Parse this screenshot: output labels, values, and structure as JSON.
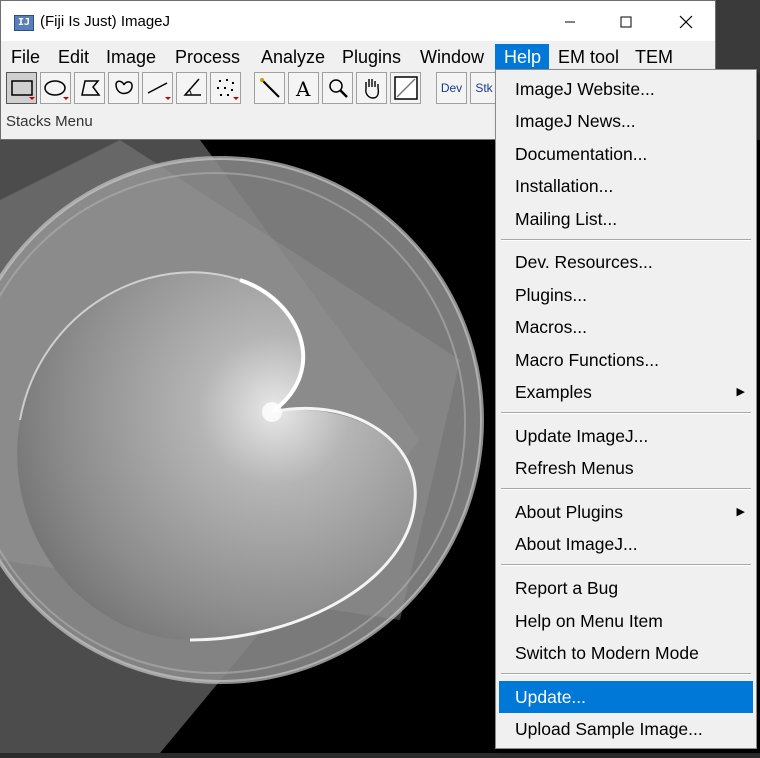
{
  "window": {
    "app_icon": "IJ",
    "title": "(Fiji Is Just) ImageJ",
    "controls": {
      "minimize": "—",
      "maximize": "☐",
      "close": "✕"
    }
  },
  "menubar": [
    "File",
    "Edit",
    "Image",
    "Process",
    "Analyze",
    "Plugins",
    "Window",
    "Help",
    "EM tool",
    "TEM"
  ],
  "menubar_active": "Help",
  "toolbar": {
    "tools": [
      "rectangle-tool",
      "oval-tool",
      "polygon-tool",
      "freehand-tool",
      "line-tool",
      "angle-tool",
      "point-tool",
      "wand-tool",
      "text-tool",
      "magnifier-tool",
      "hand-tool",
      "color-picker-tool"
    ],
    "dev_label": "Dev",
    "stk_label": "Stk"
  },
  "status_text": "Stacks Menu",
  "help_menu": {
    "items": [
      {
        "label": "ImageJ Website..."
      },
      {
        "label": "ImageJ News..."
      },
      {
        "label": "Documentation..."
      },
      {
        "label": "Installation..."
      },
      {
        "label": "Mailing List..."
      },
      {
        "label": "Dev. Resources..."
      },
      {
        "label": "Plugins..."
      },
      {
        "label": "Macros..."
      },
      {
        "label": "Macro Functions..."
      },
      {
        "label": "Examples",
        "submenu": true
      },
      {
        "label": "Update ImageJ..."
      },
      {
        "label": "Refresh Menus"
      },
      {
        "label": "About Plugins",
        "submenu": true
      },
      {
        "label": "About ImageJ..."
      },
      {
        "label": "Report a Bug"
      },
      {
        "label": "Help on Menu Item"
      },
      {
        "label": "Switch to Modern Mode"
      },
      {
        "label": "Update...",
        "highlighted": true
      },
      {
        "label": "Upload Sample Image..."
      }
    ],
    "submenu_arrow": "▶"
  },
  "colors": {
    "accent": "#0078d7",
    "menu_bg": "#f0f0f0",
    "image_bg": "#000000"
  }
}
